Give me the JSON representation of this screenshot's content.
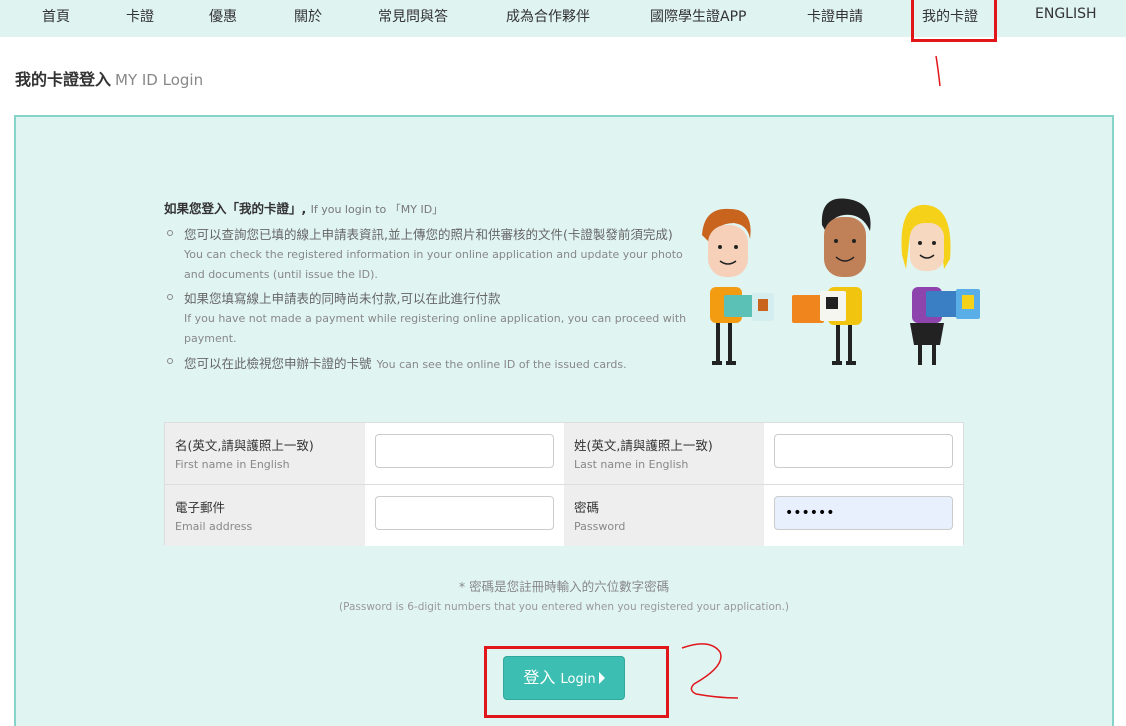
{
  "nav": {
    "items": [
      {
        "label": "首頁"
      },
      {
        "label": "卡證"
      },
      {
        "label": "優惠"
      },
      {
        "label": "關於"
      },
      {
        "label": "常見問與答"
      },
      {
        "label": "成為合作夥伴"
      },
      {
        "label": "國際學生證APP"
      },
      {
        "label": "卡證申請"
      },
      {
        "label": "我的卡證"
      },
      {
        "label": "ENGLISH"
      }
    ],
    "active": "我的卡證"
  },
  "page": {
    "title_zh": "我的卡證登入",
    "title_en": "MY ID Login"
  },
  "info": {
    "heading_zh": "如果您登入「我的卡證」,",
    "heading_en": "If you login to 「MY ID」",
    "items": [
      {
        "zh": "您可以查詢您已填的線上申請表資訊,並上傳您的照片和供審核的文件(卡證製發前須完成)",
        "en": "You can check the registered information in your online application and update your photo and documents (until issue the ID)."
      },
      {
        "zh": "如果您填寫線上申請表的同時尚未付款,可以在此進行付款",
        "en": "If you have not made a payment while registering online application, you can proceed with payment."
      },
      {
        "zh": "您可以在此檢視您申辦卡證的卡號",
        "en": "You can see the online ID of the issued cards."
      }
    ]
  },
  "form": {
    "first_name": {
      "label_zh": "名(英文,請與護照上一致)",
      "label_en": "First name in English",
      "value": ""
    },
    "last_name": {
      "label_zh": "姓(英文,請與護照上一致)",
      "label_en": "Last name in English",
      "value": ""
    },
    "email": {
      "label_zh": "電子郵件",
      "label_en": "Email address",
      "value": ""
    },
    "password": {
      "label_zh": "密碼",
      "label_en": "Password",
      "value": "••••••"
    }
  },
  "note": {
    "zh": "* 密碼是您註冊時輸入的六位數字密碼",
    "en": "(Password is 6-digit numbers that you entered when you registered your application.)"
  },
  "login_button": {
    "label_zh": "登入",
    "label_en": "Login"
  },
  "colors": {
    "nav_bg": "#dff3f1",
    "panel_bg": "#e0f4f2",
    "panel_border": "#86d3ca",
    "button": "#3cbfb2",
    "annotation": "#e0161b"
  }
}
